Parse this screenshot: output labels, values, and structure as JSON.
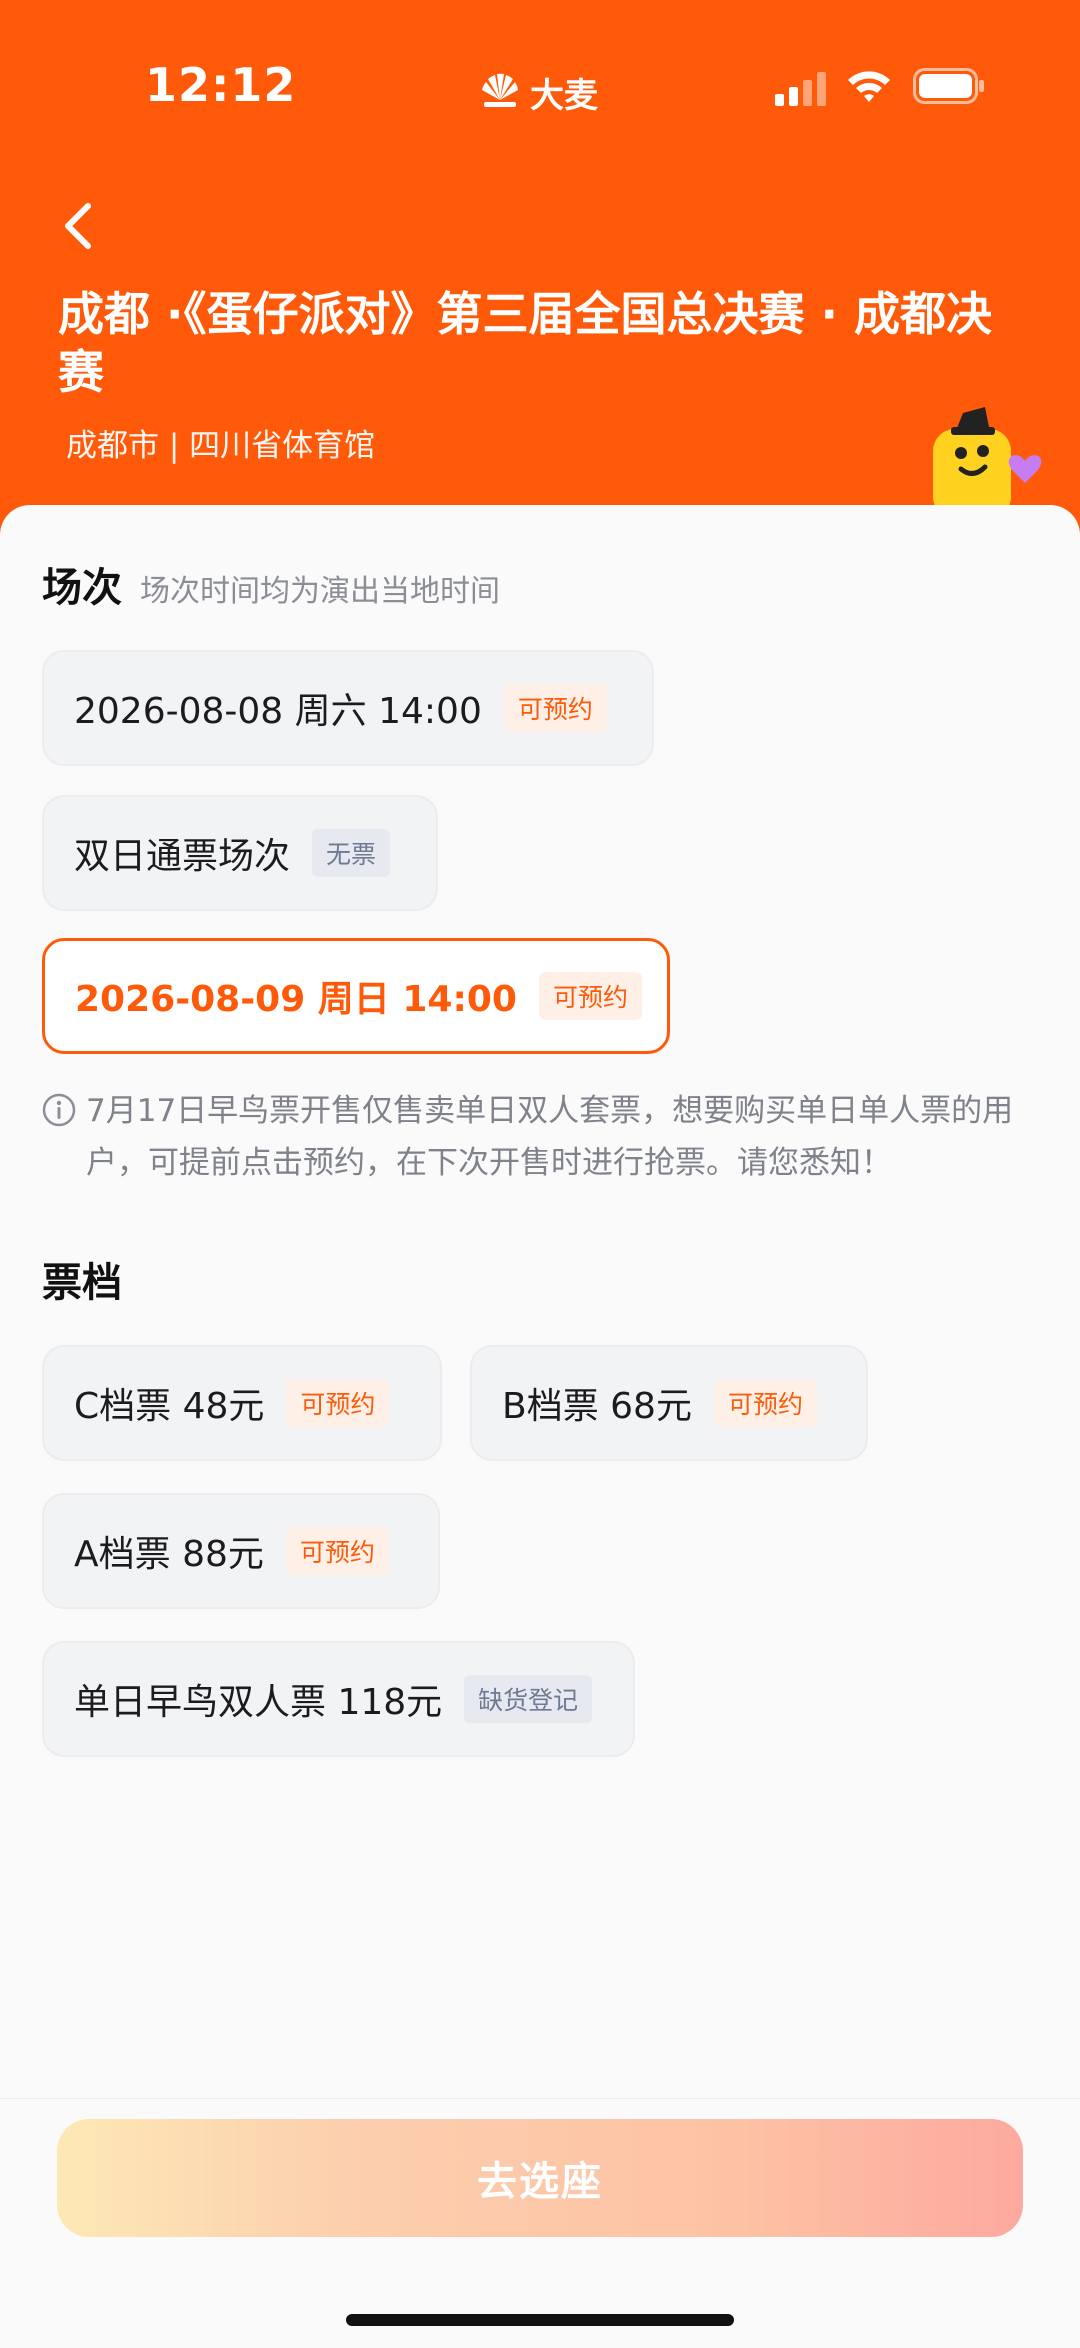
{
  "status_bar": {
    "time": "12:12",
    "brand": "大麦"
  },
  "header": {
    "title": "成都 ·《蛋仔派对》第三届全国总决赛 · 成都决赛",
    "location": "成都市 | 四川省体育馆"
  },
  "sessions": {
    "title": "场次",
    "subtitle": "场次时间均为演出当地时间",
    "items": [
      {
        "label": "2026-08-08 周六 14:00",
        "badge": "可预约"
      },
      {
        "label": "双日通票场次",
        "badge": "无票"
      },
      {
        "label": "2026-08-09 周日 14:00",
        "badge": "可预约"
      }
    ],
    "notice": "7月17日早鸟票开售仅售卖单日双人套票，想要购买单日单人票的用户，可提前点击预约，在下次开售时进行抢票。请您悉知！"
  },
  "tickets": {
    "title": "票档",
    "items": [
      {
        "label": "C档票 48元",
        "badge": "可预约"
      },
      {
        "label": "B档票 68元",
        "badge": "可预约"
      },
      {
        "label": "A档票 88元",
        "badge": "可预约"
      },
      {
        "label": "单日早鸟双人票 118元",
        "badge": "缺货登记"
      }
    ]
  },
  "bottom": {
    "cta_label": "去选座"
  },
  "colors": {
    "brand_orange": "#ff5a0a",
    "badge_orange_bg": "#fff0e7",
    "badge_gray_text": "#6f7a93",
    "chip_bg": "#f2f3f5"
  }
}
